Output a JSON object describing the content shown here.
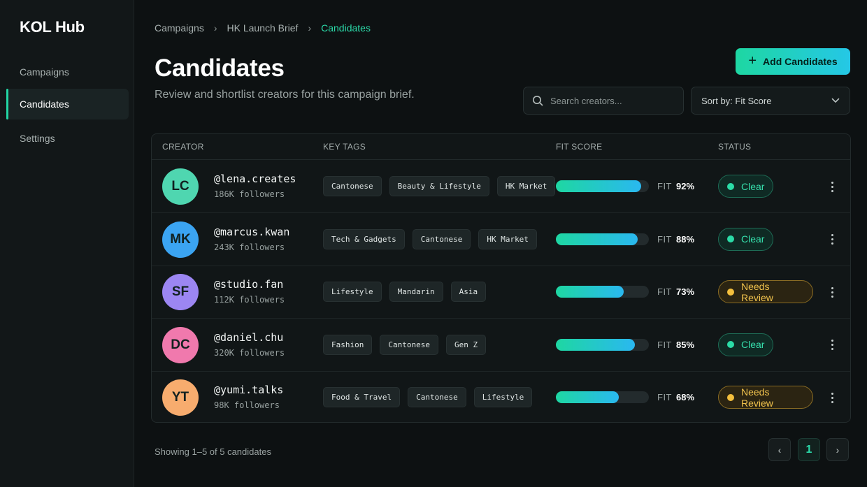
{
  "app": {
    "brand": "KOL Hub"
  },
  "sidebar": {
    "items": [
      {
        "label": "Campaigns",
        "active": false
      },
      {
        "label": "Candidates",
        "active": true
      },
      {
        "label": "Settings",
        "active": false
      }
    ]
  },
  "breadcrumb": [
    "Campaigns",
    "HK Launch Brief",
    "Candidates"
  ],
  "page": {
    "title": "Candidates",
    "subtitle": "Review and shortlist creators for this campaign brief."
  },
  "toolbar": {
    "add_label": "Add Candidates",
    "search_placeholder": "Search creators...",
    "sort_label": "Sort by: Fit Score"
  },
  "table": {
    "headers": [
      "CREATOR",
      "KEY TAGS",
      "FIT SCORE",
      "STATUS"
    ],
    "rows": [
      {
        "initials": "LC",
        "avatar_color": "#4fd6b0",
        "handle": "@lena.creates",
        "followers": "186K followers",
        "tags": [
          "Cantonese",
          "Beauty & Lifestyle",
          "HK Market"
        ],
        "fit_label": "FIT",
        "fit": 92,
        "fit_text": "92%",
        "status": "Clear",
        "status_kind": "clear"
      },
      {
        "initials": "MK",
        "avatar_color": "#3ba4f2",
        "handle": "@marcus.kwan",
        "followers": "243K followers",
        "tags": [
          "Tech & Gadgets",
          "Cantonese",
          "HK Market"
        ],
        "fit_label": "FIT",
        "fit": 88,
        "fit_text": "88%",
        "status": "Clear",
        "status_kind": "clear"
      },
      {
        "initials": "SF",
        "avatar_color": "#9c86f2",
        "handle": "@studio.fan",
        "followers": "112K followers",
        "tags": [
          "Lifestyle",
          "Mandarin",
          "Asia"
        ],
        "fit_label": "FIT",
        "fit": 73,
        "fit_text": "73%",
        "status": "Needs Review",
        "status_kind": "review"
      },
      {
        "initials": "DC",
        "avatar_color": "#f079ad",
        "handle": "@daniel.chu",
        "followers": "320K followers",
        "tags": [
          "Fashion",
          "Cantonese",
          "Gen Z"
        ],
        "fit_label": "FIT",
        "fit": 85,
        "fit_text": "85%",
        "status": "Clear",
        "status_kind": "clear"
      },
      {
        "initials": "YT",
        "avatar_color": "#f7ac6e",
        "handle": "@yumi.talks",
        "followers": "98K followers",
        "tags": [
          "Food & Travel",
          "Cantonese",
          "Lifestyle"
        ],
        "fit_label": "FIT",
        "fit": 68,
        "fit_text": "68%",
        "status": "Needs Review",
        "status_kind": "review"
      }
    ]
  },
  "footer": {
    "summary": "Showing 1–5 of 5 candidates"
  },
  "pagination": {
    "prev": "‹",
    "current": "1",
    "next": "›"
  }
}
